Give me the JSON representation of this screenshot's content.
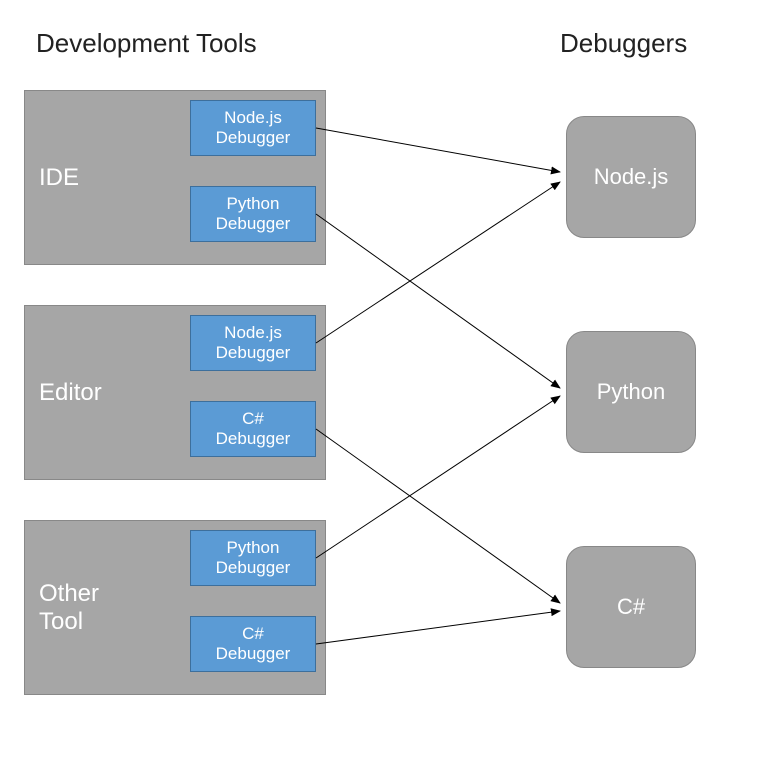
{
  "headings": {
    "left": "Development Tools",
    "right": "Debuggers"
  },
  "tools": [
    {
      "name": "IDE",
      "plugins": [
        {
          "label": "Node.js\nDebugger",
          "targets": "nodejs"
        },
        {
          "label": "Python\nDebugger",
          "targets": "python"
        }
      ]
    },
    {
      "name": "Editor",
      "plugins": [
        {
          "label": "Node.js\nDebugger",
          "targets": "nodejs"
        },
        {
          "label": "C#\nDebugger",
          "targets": "csharp"
        }
      ]
    },
    {
      "name": "Other\nTool",
      "plugins": [
        {
          "label": "Python\nDebugger",
          "targets": "python"
        },
        {
          "label": "C#\nDebugger",
          "targets": "csharp"
        }
      ]
    }
  ],
  "debuggers": {
    "nodejs": "Node.js",
    "python": "Python",
    "csharp": "C#"
  }
}
